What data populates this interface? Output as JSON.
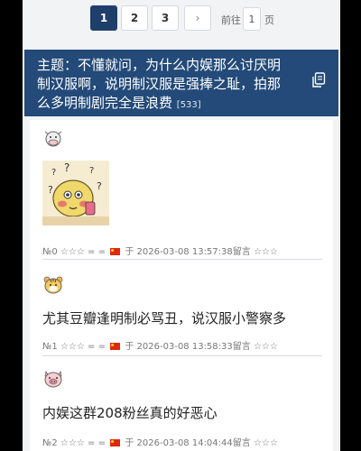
{
  "pagination": {
    "pages": [
      "1",
      "2",
      "3"
    ],
    "current": "1",
    "next_label": "›",
    "goto_label": "前往",
    "goto_value": "1",
    "goto_unit": "页"
  },
  "topic": {
    "text": "主题：不懂就问，为什么内娱那么讨厌明制汉服啊，说明制汉服是强捧之耻，拍那么多明制剧完全是浪费",
    "count": "[533]"
  },
  "posts": [
    {
      "avatar": "cow-icon",
      "image": "sticker-image",
      "text": "",
      "number": "№0",
      "stars": "☆☆☆",
      "sep": "= =",
      "at": "于",
      "datetime": "2026-03-08 13:57:38",
      "suffix": "留言",
      "stars2": "☆☆☆"
    },
    {
      "avatar": "tiger-icon",
      "text": "尤其豆瓣逢明制必骂丑，说汉服小警察多",
      "number": "№1",
      "stars": "☆☆☆",
      "sep": "= =",
      "at": "于",
      "datetime": "2026-03-08 13:58:33",
      "suffix": "留言",
      "stars2": "☆☆☆"
    },
    {
      "avatar": "pig-icon",
      "text": "内娱这群208粉丝真的好恶心",
      "number": "№2",
      "stars": "☆☆☆",
      "sep": "= =",
      "at": "于",
      "datetime": "2026-03-08 14:04:44",
      "suffix": "留言",
      "stars2": "☆☆☆"
    }
  ],
  "colors": {
    "accent": "#234a78",
    "flag_red": "#de2910"
  }
}
